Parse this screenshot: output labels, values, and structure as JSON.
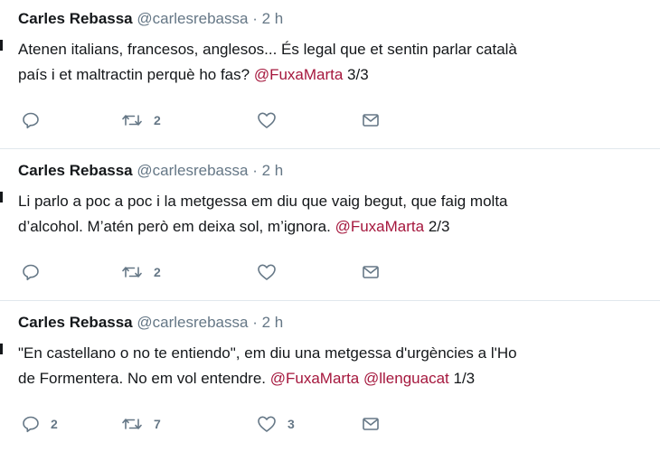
{
  "tweets": [
    {
      "name": "Carles Rebassa",
      "handle": "@carlesrebassa",
      "separator": "·",
      "time": "2 h",
      "line1": "Atenen italians, francesos, anglesos... És legal que et sentin parlar català",
      "line2_text": "país i et maltractin perquè ho fas? ",
      "line2_mention": "@FuxaMarta",
      "line2_tail": " 3/3",
      "replies": "",
      "retweets": "2",
      "likes": ""
    },
    {
      "name": "Carles Rebassa",
      "handle": "@carlesrebassa",
      "separator": "·",
      "time": "2 h",
      "line1": "Li parlo a poc a poc i la metgessa em diu que vaig begut, que faig molta",
      "line2_text": "d’alcohol. M’atén però em deixa sol, m’ignora. ",
      "line2_mention": "@FuxaMarta",
      "line2_tail": " 2/3",
      "replies": "",
      "retweets": "2",
      "likes": ""
    },
    {
      "name": "Carles Rebassa",
      "handle": "@carlesrebassa",
      "separator": "·",
      "time": "2 h",
      "line1": "\"En castellano o no te entiendo\", em diu una metgessa d'urgències a l'Ho",
      "line2_text": "de Formentera. No em vol entendre. ",
      "line2_mention": "@FuxaMarta",
      "line2_mention2": "@llenguacat",
      "line2_tail": " 1/3",
      "replies": "2",
      "retweets": "7",
      "likes": "3"
    }
  ],
  "colors": {
    "mention": "#a5173d",
    "muted": "#657786",
    "divider": "#e1e8ed"
  },
  "icons": [
    "reply-icon",
    "retweet-icon",
    "like-icon",
    "direct-message-icon"
  ]
}
